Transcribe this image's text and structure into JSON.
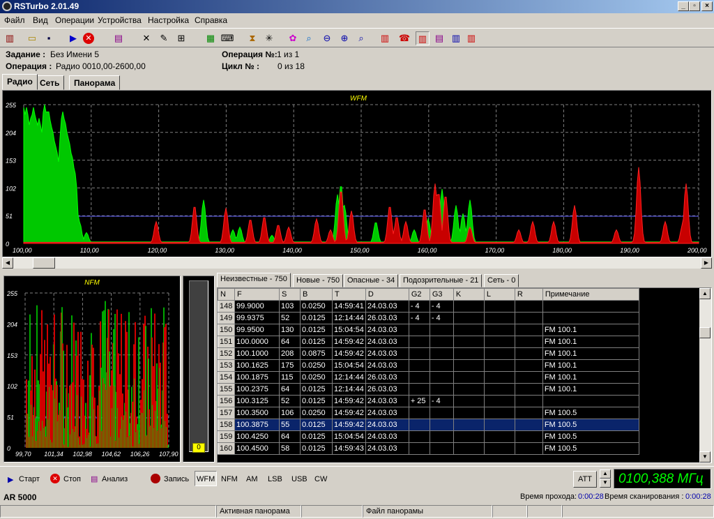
{
  "window": {
    "title": "RSTurbo  2.01.49"
  },
  "menu": [
    "Файл",
    "Вид",
    "Операции",
    "Устройства",
    "Настройка",
    "Справка"
  ],
  "info": {
    "task_label": "Задание :",
    "task_value": "Без Имени 5",
    "op_label": "Операция :",
    "op_value": "Радио 0010,00-2600,00",
    "opno_label": "Операция №:",
    "opno_value": "1 из 1",
    "cycle_label": "Цикл № :",
    "cycle_value": "0 из 18"
  },
  "tabs": [
    "Радио",
    "Сеть",
    "Панорама"
  ],
  "main_chart": {
    "title": "WFM",
    "yticks": [
      "255",
      "204",
      "153",
      "102",
      "51",
      "0"
    ],
    "xticks": [
      "100,00",
      "110,00",
      "120,00",
      "130,00",
      "140,00",
      "150,00",
      "160,00",
      "170,00",
      "180,00",
      "190,00",
      "200,00"
    ]
  },
  "nfm_chart": {
    "title": "NFM",
    "yticks": [
      "255",
      "204",
      "153",
      "102",
      "51",
      "0"
    ],
    "xticks": [
      "99,70",
      "101,34",
      "102,98",
      "104,62",
      "106,26",
      "107,90"
    ]
  },
  "level": {
    "value": "0"
  },
  "table_tabs": [
    "Неизвестные - 750",
    "Новые - 750",
    "Опасные - 34",
    "Подозрительные - 21",
    "Сеть - 0"
  ],
  "columns": [
    "N",
    "F",
    "S",
    "B",
    "T",
    "D",
    "G2",
    "G3",
    "K",
    "L",
    "R",
    "Примечание"
  ],
  "rows": [
    [
      "148",
      "99.9000",
      "103",
      "0.0250",
      "14:59:41",
      "24.03.03",
      "- 4",
      "- 4",
      "",
      "",
      "",
      ""
    ],
    [
      "149",
      "99.9375",
      "52",
      "0.0125",
      "12:14:44",
      "26.03.03",
      "- 4",
      "- 4",
      "",
      "",
      "",
      ""
    ],
    [
      "150",
      "99.9500",
      "130",
      "0.0125",
      "15:04:54",
      "24.03.03",
      "",
      "",
      "",
      "",
      "",
      "FM 100.1"
    ],
    [
      "151",
      "100.0000",
      "64",
      "0.0125",
      "14:59:42",
      "24.03.03",
      "",
      "",
      "",
      "",
      "",
      "FM 100.1"
    ],
    [
      "152",
      "100.1000",
      "208",
      "0.0875",
      "14:59:42",
      "24.03.03",
      "",
      "",
      "",
      "",
      "",
      "FM 100.1"
    ],
    [
      "153",
      "100.1625",
      "175",
      "0.0250",
      "15:04:54",
      "24.03.03",
      "",
      "",
      "",
      "",
      "",
      "FM 100.1"
    ],
    [
      "154",
      "100.1875",
      "115",
      "0.0250",
      "12:14:44",
      "26.03.03",
      "",
      "",
      "",
      "",
      "",
      "FM 100.1"
    ],
    [
      "155",
      "100.2375",
      "64",
      "0.0125",
      "12:14:44",
      "26.03.03",
      "",
      "",
      "",
      "",
      "",
      "FM 100.1"
    ],
    [
      "156",
      "100.3125",
      "52",
      "0.0125",
      "14:59:42",
      "24.03.03",
      "+ 25",
      "- 4",
      "",
      "",
      "",
      ""
    ],
    [
      "157",
      "100.3500",
      "106",
      "0.0250",
      "14:59:42",
      "24.03.03",
      "",
      "",
      "",
      "",
      "",
      "FM 100.5"
    ],
    [
      "158",
      "100.3875",
      "55",
      "0.0125",
      "14:59:42",
      "24.03.03",
      "",
      "",
      "",
      "",
      "",
      "FM 100.5"
    ],
    [
      "159",
      "100.4250",
      "64",
      "0.0125",
      "15:04:54",
      "24.03.03",
      "",
      "",
      "",
      "",
      "",
      "FM 100.5"
    ],
    [
      "160",
      "100.4500",
      "58",
      "0.0125",
      "14:59:43",
      "24.03.03",
      "",
      "",
      "",
      "",
      "",
      "FM 100.5"
    ]
  ],
  "selected_row": "158",
  "controls": {
    "start": "Старт",
    "stop": "Стоп",
    "analyze": "Анализ",
    "record": "Запись",
    "modes": [
      "WFM",
      "NFM",
      "AM",
      "LSB",
      "USB",
      "CW"
    ],
    "att": "ATT",
    "freq": "0100,388 МГц"
  },
  "status": {
    "device": "AR 5000",
    "pass_label": "Время прохода:",
    "pass_value": "0:00:28",
    "scan_label": "Время сканирования :",
    "scan_value": "0:00:28",
    "active_pan": "Активная панорама",
    "pan_file": "Файл панорамы"
  },
  "colors": {
    "green": "#00d000",
    "red": "#d00000",
    "freq_green": "#00ff00"
  }
}
